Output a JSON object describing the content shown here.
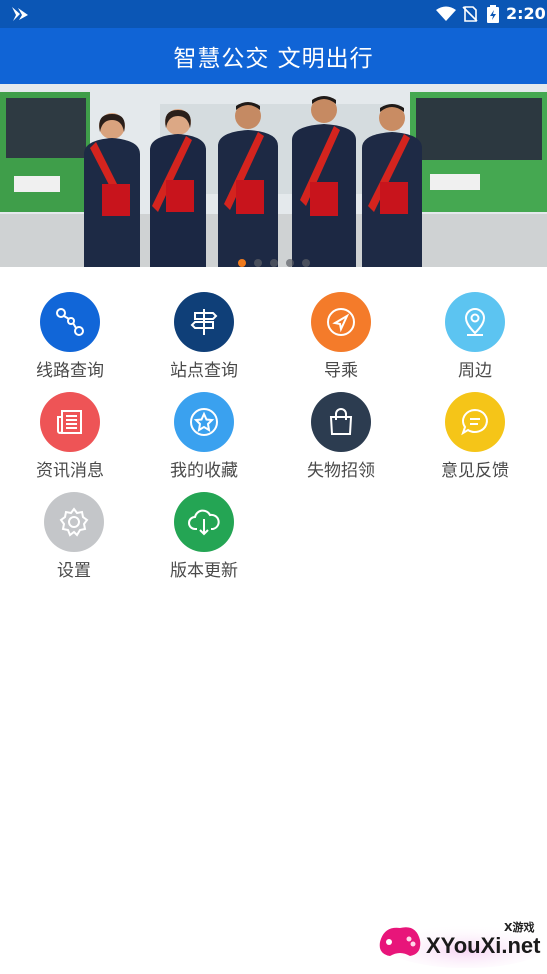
{
  "status_bar": {
    "time": "2:20"
  },
  "header": {
    "title": "智慧公交 文明出行"
  },
  "banner": {
    "slide_count": 5,
    "active_slide": 1
  },
  "menu": [
    {
      "label": "线路查询",
      "icon": "route-icon",
      "color": "#1166d8"
    },
    {
      "label": "站点查询",
      "icon": "signpost-icon",
      "color": "#0f3f78"
    },
    {
      "label": "导乘",
      "icon": "compass-icon",
      "color": "#f47b2a"
    },
    {
      "label": "周边",
      "icon": "location-pin-icon",
      "color": "#5cc4f1"
    },
    {
      "label": "资讯消息",
      "icon": "newspaper-icon",
      "color": "#ee5456"
    },
    {
      "label": "我的收藏",
      "icon": "star-icon",
      "color": "#3aa1ef"
    },
    {
      "label": "失物招领",
      "icon": "shopping-bag-icon",
      "color": "#2c3c50"
    },
    {
      "label": "意见反馈",
      "icon": "chat-bubble-icon",
      "color": "#f5c518"
    },
    {
      "label": "设置",
      "icon": "gear-icon",
      "color": "#c4c6c9"
    },
    {
      "label": "版本更新",
      "icon": "cloud-download-icon",
      "color": "#24a554"
    }
  ],
  "watermark": {
    "brand": "X游戏",
    "site": "XYouXi.net"
  }
}
